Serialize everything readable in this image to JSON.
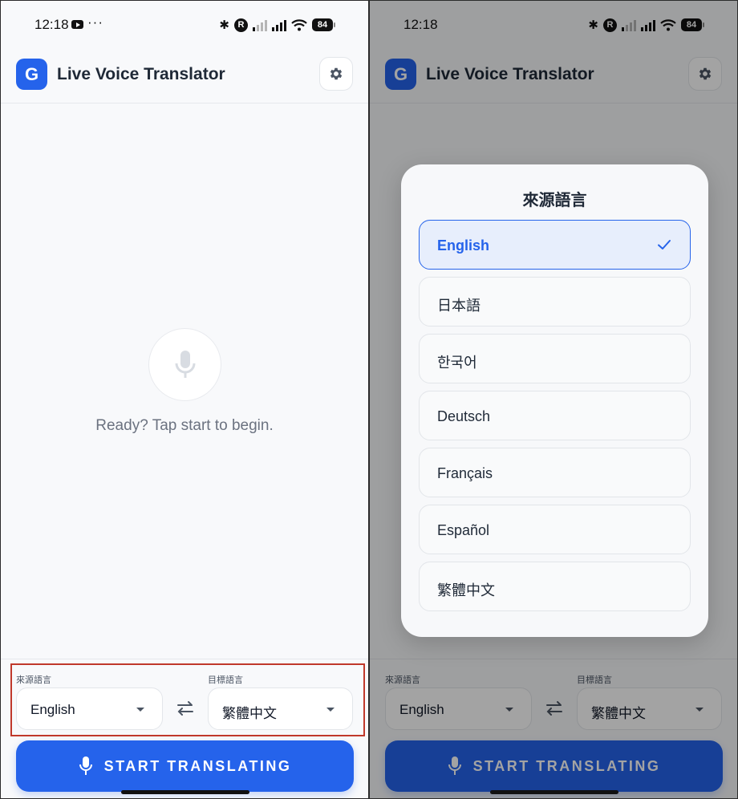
{
  "status_bar": {
    "time": "12:18",
    "more": "···",
    "roaming": "R",
    "battery": "84"
  },
  "app": {
    "logo_letter": "G",
    "title": "Live Voice Translator"
  },
  "main": {
    "prompt": "Ready? Tap start to begin."
  },
  "language_bar": {
    "source_label": "來源語言",
    "source_value": "English",
    "target_label": "目標語言",
    "target_value": "繁體中文"
  },
  "start_button": {
    "label": "START TRANSLATING"
  },
  "modal": {
    "title": "來源語言",
    "options": [
      {
        "label": "English",
        "selected": true
      },
      {
        "label": "日本語",
        "selected": false
      },
      {
        "label": "한국어",
        "selected": false
      },
      {
        "label": "Deutsch",
        "selected": false
      },
      {
        "label": "Français",
        "selected": false
      },
      {
        "label": "Español",
        "selected": false
      },
      {
        "label": "繁體中文",
        "selected": false
      }
    ]
  },
  "colors": {
    "accent": "#2563eb",
    "highlight": "#c0392b"
  },
  "icons": [
    "settings-gear-icon",
    "microphone-icon",
    "swap-arrows-icon",
    "checkmark-icon",
    "dropdown-caret-icon"
  ]
}
